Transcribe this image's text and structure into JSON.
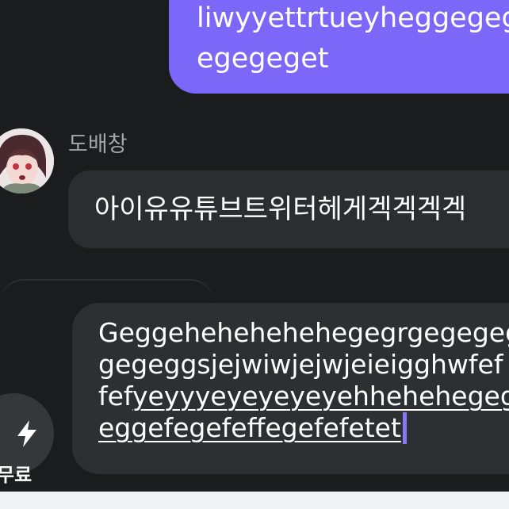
{
  "messages": {
    "outgoing": {
      "line1": "liwyyettrtueyheggegeg",
      "line2": "egegeget"
    },
    "incoming": {
      "sender": "도배창",
      "text": "아이유유튜브트위터헤게겍겍겍겍"
    }
  },
  "composer": {
    "line1": "Geggehehehehehegegrgegegeg",
    "line2": "gegeggsjejwiwjejwjeieigghwfef",
    "line3_plain": "fef",
    "line3_underlined": "yeyyyeyeyeyeyehhehehegeg",
    "line4_underlined": "eggefegefeffegefefetet"
  },
  "quick_action": {
    "label": "무료",
    "icon": "lightning-icon"
  },
  "colors": {
    "background": "#1b1c1e",
    "outgoing_bubble": "#7b68f8",
    "incoming_bubble": "#2c2d31",
    "composer": "#2e2f33",
    "caret": "#8778f9"
  }
}
